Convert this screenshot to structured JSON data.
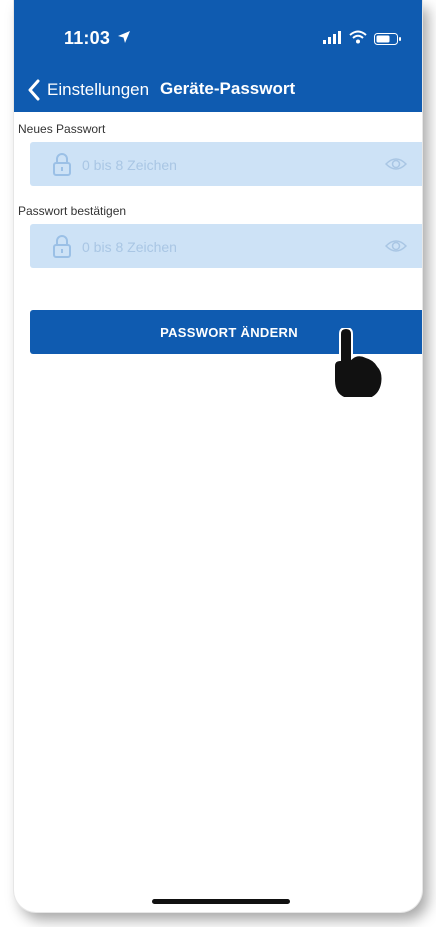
{
  "status_bar": {
    "time": "11:03",
    "icons": [
      "location-arrow-icon",
      "signal-icon",
      "wifi-icon",
      "battery-icon"
    ]
  },
  "nav": {
    "back_label": "Einstellungen",
    "title": "Geräte-Passwort",
    "back_icon": "chevron-left-icon"
  },
  "form": {
    "new_password": {
      "label": "Neues Passwort",
      "placeholder": "0 bis 8 Zeichen",
      "value": "",
      "icons": [
        "lock-icon",
        "eye-icon"
      ]
    },
    "confirm_password": {
      "label": "Passwort bestätigen",
      "placeholder": "0 bis 8 Zeichen",
      "value": "",
      "icons": [
        "lock-icon",
        "eye-icon"
      ]
    },
    "submit_label": "PASSWORT ÄNDERN"
  },
  "colors": {
    "brand_blue": "#0f5bb0",
    "input_background": "#cde2f6",
    "placeholder": "#a9c6e4",
    "background": "#ffffff"
  }
}
